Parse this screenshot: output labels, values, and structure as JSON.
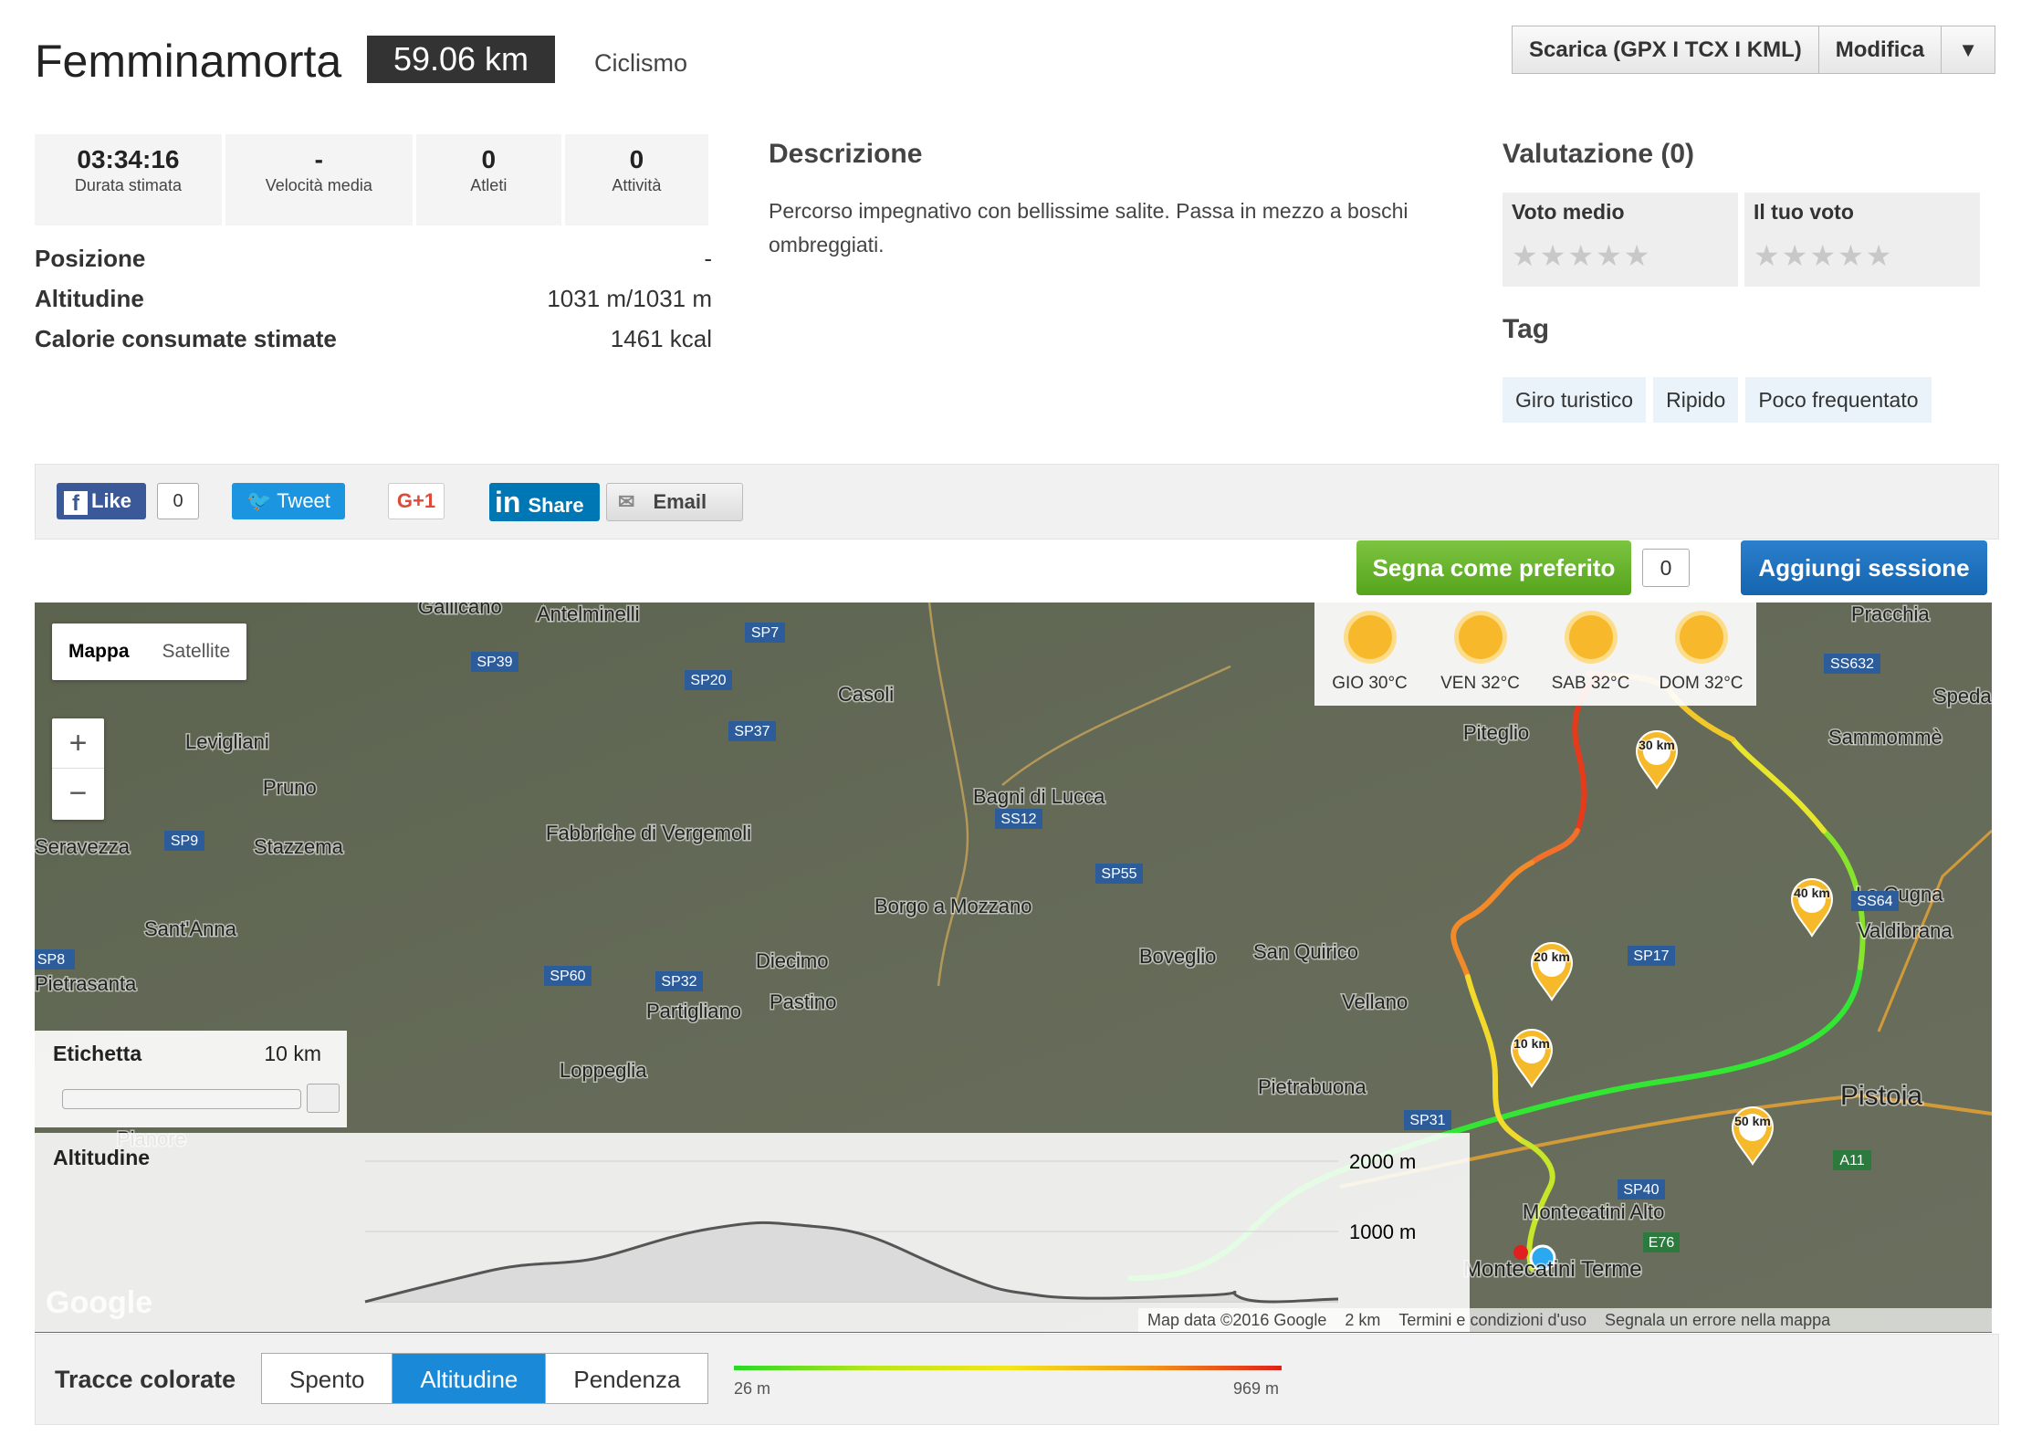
{
  "header": {
    "title": "Femminamorta",
    "distance": "59.06 km",
    "activity": "Ciclismo",
    "download_label": "Scarica (GPX I TCX I KML)",
    "edit_label": "Modifica",
    "dropdown_glyph": "▼"
  },
  "stats": [
    {
      "value": "03:34:16",
      "label": "Durata stimata"
    },
    {
      "value": "-",
      "label": "Velocità media"
    },
    {
      "value": "0",
      "label": "Atleti"
    },
    {
      "value": "0",
      "label": "Attività"
    }
  ],
  "info": [
    {
      "key": "Posizione",
      "value": "-"
    },
    {
      "key": "Altitudine",
      "value": "1031 m/1031 m"
    },
    {
      "key": "Calorie consumate stimate",
      "value": "1461 kcal"
    }
  ],
  "description": {
    "title": "Descrizione",
    "text": "Percorso impegnativo con bellissime salite. Passa in mezzo a boschi ombreggiati."
  },
  "rating": {
    "title": "Valutazione (0)",
    "average_label": "Voto medio",
    "your_label": "Il tuo voto",
    "max_stars": 5,
    "average_value": 0
  },
  "tags": {
    "title": "Tag",
    "items": [
      "Giro turistico",
      "Ripido",
      "Poco frequentato"
    ]
  },
  "share": {
    "like_label": "Like",
    "like_count": "0",
    "tweet_label": "Tweet",
    "gplus_label": "G+1",
    "linkedin_icon": "in",
    "linkedin_label": "Share",
    "email_label": "Email"
  },
  "actions": {
    "favorite_label": "Segna come preferito",
    "favorite_count": "0",
    "add_session_label": "Aggiungi sessione"
  },
  "map": {
    "type_options": [
      "Mappa",
      "Satellite"
    ],
    "selected_type": "Mappa",
    "zoom_in": "+",
    "zoom_out": "−",
    "weather": [
      {
        "label": "GIO 30°C",
        "icon": "sun-icon"
      },
      {
        "label": "VEN 32°C",
        "icon": "sun-icon"
      },
      {
        "label": "SAB 32°C",
        "icon": "sun-icon"
      },
      {
        "label": "DOM 32°C",
        "icon": "sun-icon"
      }
    ],
    "label_panel": {
      "title": "Etichetta",
      "value": "10 km"
    },
    "altitude_panel": {
      "title": "Altitudine",
      "axis": [
        "2000 m",
        "1000 m"
      ]
    },
    "markers": [
      "10 km",
      "20 km",
      "30 km",
      "40 km",
      "50 km"
    ],
    "places": [
      "Gallicano",
      "Antelminelli",
      "Casoli",
      "Pracchia",
      "Levigliani",
      "Pruno",
      "Seravezza",
      "Stazzema",
      "Sant'Anna",
      "Pietrasanta",
      "Fabbriche di Vergemoli",
      "Bagni di Lucca",
      "Borgo a Mozzano",
      "Diecimo",
      "Pastino",
      "Partigliano",
      "Loppeglia",
      "Boveglio",
      "San Quirico",
      "Vellano",
      "Pietrabuona",
      "Piteglio",
      "Sammommè",
      "La Cugna",
      "Valdibrana",
      "Pistoia",
      "Montecatini Alto",
      "Montecatini Terme",
      "Speda",
      "Pianore"
    ],
    "roads": [
      "SP7",
      "SP39",
      "SP20",
      "SP37",
      "SP9",
      "SP8",
      "SP60",
      "SP32",
      "SS12",
      "SP55",
      "SP17",
      "SS64",
      "SS632",
      "SP31",
      "SP40",
      "A11",
      "E76"
    ],
    "attribution": "Map data ©2016 Google",
    "scale": "2 km",
    "terms": "Termini e condizioni d'uso",
    "report": "Segnala un errore nella mappa",
    "logo": "Google"
  },
  "colored_tracks": {
    "label": "Tracce colorate",
    "options": [
      "Spento",
      "Altitudine",
      "Pendenza"
    ],
    "selected": "Altitudine",
    "min": "26 m",
    "max": "969 m"
  },
  "colors": {
    "favorite": "#56a41c",
    "add_session": "#1565b0",
    "selected_segment": "#1a8ad8",
    "distance_badge": "#333333"
  }
}
